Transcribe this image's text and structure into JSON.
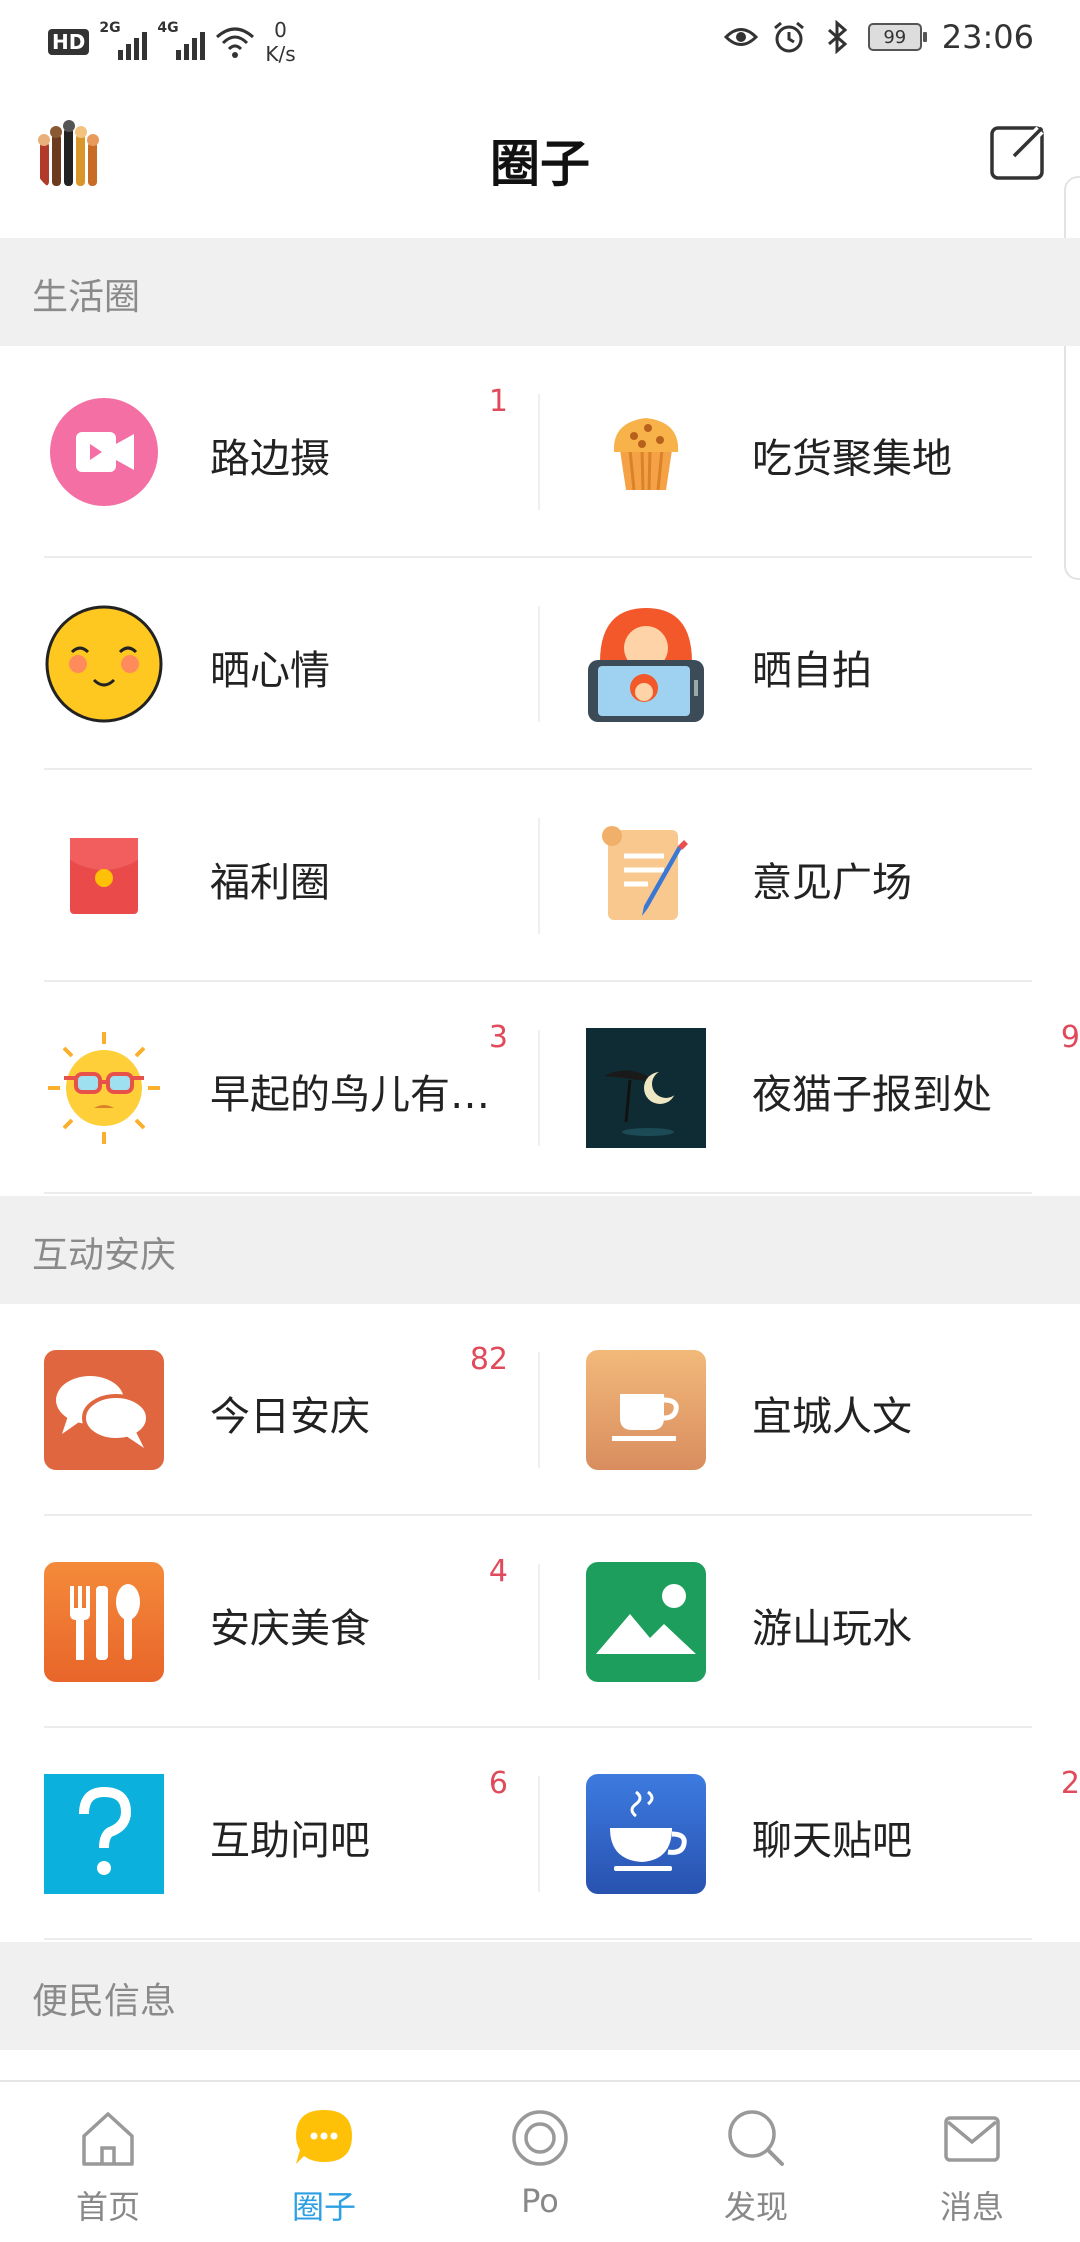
{
  "status_bar": {
    "hd": "HD",
    "sim1": "2G",
    "sim2": "4G",
    "speed_value": "0",
    "speed_unit": "K/s",
    "battery": "99",
    "time": "23:06"
  },
  "header": {
    "title": "圈子",
    "avatar_icon": "avatar-hands-icon",
    "compose_icon": "edit-square-icon"
  },
  "sections": [
    {
      "title": "生活圈"
    },
    {
      "title": "互动安庆"
    },
    {
      "title": "便民信息"
    }
  ],
  "life_circle": [
    {
      "label": "路边摄",
      "badge": "1",
      "icon": "video-camera-icon",
      "color": "#f26aa0"
    },
    {
      "label": "吃货聚集地",
      "badge": "",
      "icon": "muffin-icon",
      "color": "#f3a545"
    },
    {
      "label": "晒心情",
      "badge": "",
      "icon": "smiley-face-icon",
      "color": "#ffc820"
    },
    {
      "label": "晒自拍",
      "badge": "",
      "icon": "selfie-phone-icon",
      "color": "#f26a2e"
    },
    {
      "label": "福利圈",
      "badge": "",
      "icon": "red-envelope-icon",
      "color": "#e84a4a"
    },
    {
      "label": "意见广场",
      "badge": "",
      "icon": "scroll-pen-icon",
      "color": "#f5c98a"
    },
    {
      "label": "早起的鸟儿有…",
      "badge": "3",
      "icon": "sun-glasses-icon",
      "color": "#fbc02d"
    },
    {
      "label": "夜猫子报到处",
      "badge": "9",
      "icon": "night-moon-icon",
      "color": "#0f2c35"
    }
  ],
  "interactive_anqing": [
    {
      "label": "今日安庆",
      "badge": "82",
      "icon": "chat-bubbles-icon",
      "color": "#e06640"
    },
    {
      "label": "宜城人文",
      "badge": "",
      "icon": "tea-cup-icon",
      "color": "#e9a06c"
    },
    {
      "label": "安庆美食",
      "badge": "4",
      "icon": "fork-knife-icon",
      "color": "#f07a3a"
    },
    {
      "label": "游山玩水",
      "badge": "",
      "icon": "landscape-icon",
      "color": "#1e9e5c"
    },
    {
      "label": "互助问吧",
      "badge": "6",
      "icon": "question-mark-icon",
      "color": "#0bb0dc"
    },
    {
      "label": "聊天贴吧",
      "badge": "2",
      "icon": "coffee-cup-icon",
      "color": "#2f64c6"
    }
  ],
  "bottom_nav": [
    {
      "label": "首页",
      "icon": "home-icon"
    },
    {
      "label": "圈子",
      "icon": "chat-bubble-icon",
      "active": true
    },
    {
      "label": "Po",
      "icon": "circle-icon"
    },
    {
      "label": "发现",
      "icon": "search-icon"
    },
    {
      "label": "消息",
      "icon": "mail-icon"
    }
  ]
}
